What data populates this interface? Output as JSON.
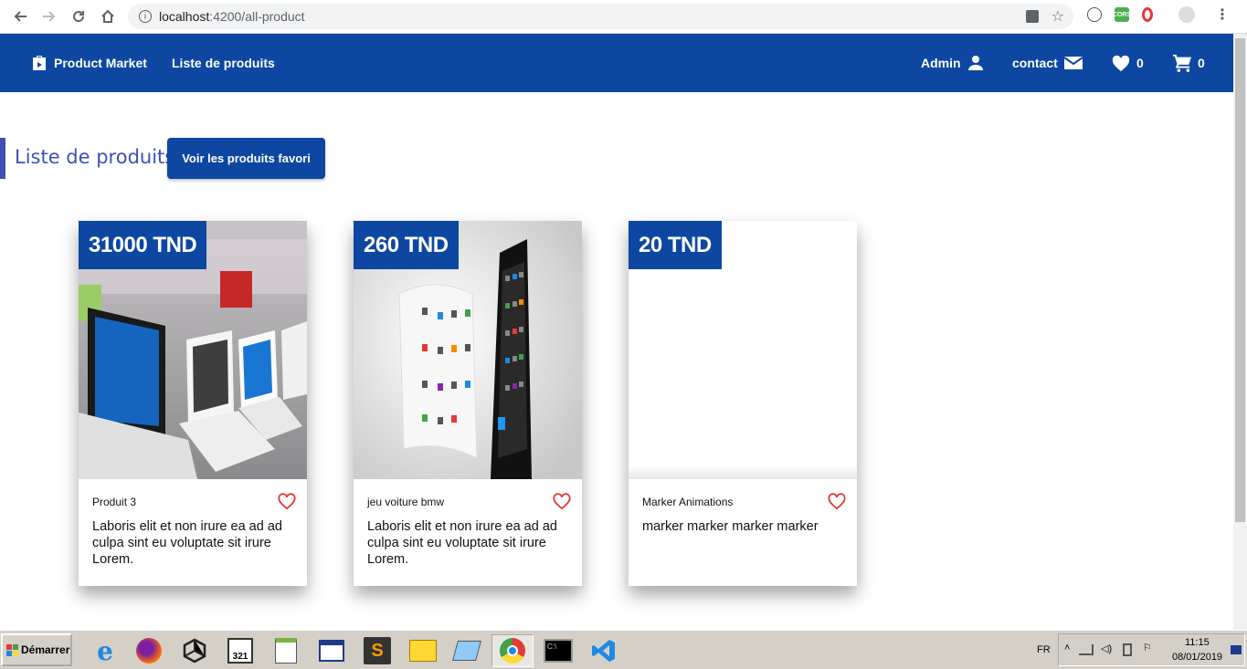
{
  "browser": {
    "url_host": "localhost",
    "url_path": ":4200/all-product"
  },
  "nav": {
    "brand": "Product Market",
    "products_link": "Liste de produits",
    "admin_label": "Admin",
    "contact_label": "contact",
    "favorites_count": "0",
    "cart_count": "0"
  },
  "main": {
    "title": "Liste de produits",
    "favorites_button": "Voir les produits favori"
  },
  "products": [
    {
      "price": "31000 TND",
      "name": "Produit 3",
      "description": "Laboris elit et non irure ea ad ad culpa sint eu voluptate sit irure Lorem."
    },
    {
      "price": "260 TND",
      "name": "jeu voiture bmw",
      "description": "Laboris elit et non irure ea ad ad culpa sint eu voluptate sit irure Lorem."
    },
    {
      "price": "20 TND",
      "name": "Marker Animations",
      "description": "marker marker marker marker"
    }
  ],
  "taskbar": {
    "start_label": "Démarrer",
    "language": "FR",
    "time": "11:15",
    "date": "08/01/2019"
  },
  "colors": {
    "primary": "#0d47a1",
    "accent": "#3f51b5",
    "heart": "#e53935"
  }
}
